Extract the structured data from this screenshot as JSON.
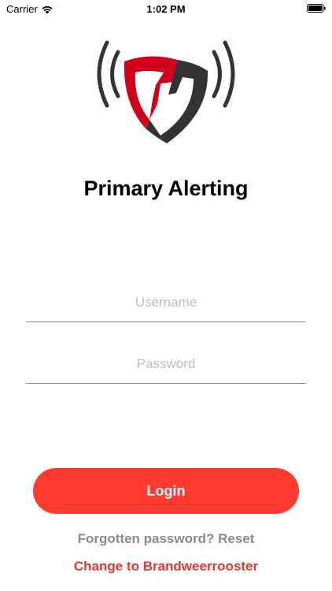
{
  "status_bar": {
    "carrier": "Carrier",
    "time": "1:02 PM",
    "icons": [
      "wifi-icon",
      "battery-icon"
    ]
  },
  "logo": {
    "icon": "shield-alert-logo",
    "colors": {
      "red": "#d0021b",
      "dark": "#333333"
    }
  },
  "app_title": "Primary Alerting",
  "form": {
    "username_placeholder": "Username",
    "password_placeholder": "Password",
    "login_label": "Login"
  },
  "links": {
    "forgot": "Forgotten password? Reset",
    "switch": "Change to Brandweerrooster"
  },
  "colors": {
    "accent": "#ff3b30",
    "link_red": "#e8362b",
    "muted": "#8a8a8e"
  }
}
